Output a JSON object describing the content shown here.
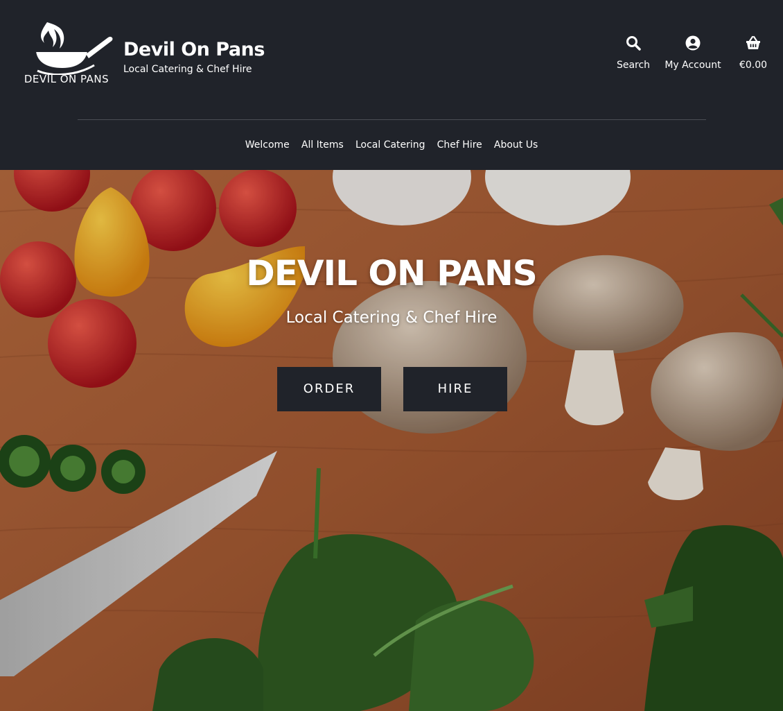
{
  "header": {
    "logo_text": "DEVIL ON PANS",
    "site_title": "Devil On Pans",
    "tagline": "Local Catering & Chef Hire",
    "actions": {
      "search": {
        "label": "Search",
        "icon": "search-icon"
      },
      "account": {
        "label": "My Account",
        "icon": "account-icon"
      },
      "cart": {
        "label": "€0.00",
        "icon": "basket-icon"
      }
    }
  },
  "nav": {
    "items": [
      "Welcome",
      "All Items",
      "Local Catering",
      "Chef Hire",
      "About Us"
    ]
  },
  "hero": {
    "title": "DEVIL ON PANS",
    "subtitle": "Local Catering & Chef Hire",
    "buttons": {
      "order": "ORDER",
      "hire": "HIRE"
    }
  },
  "colors": {
    "header_bg": "#20232a",
    "button_bg": "#20232a",
    "text": "#ffffff"
  }
}
